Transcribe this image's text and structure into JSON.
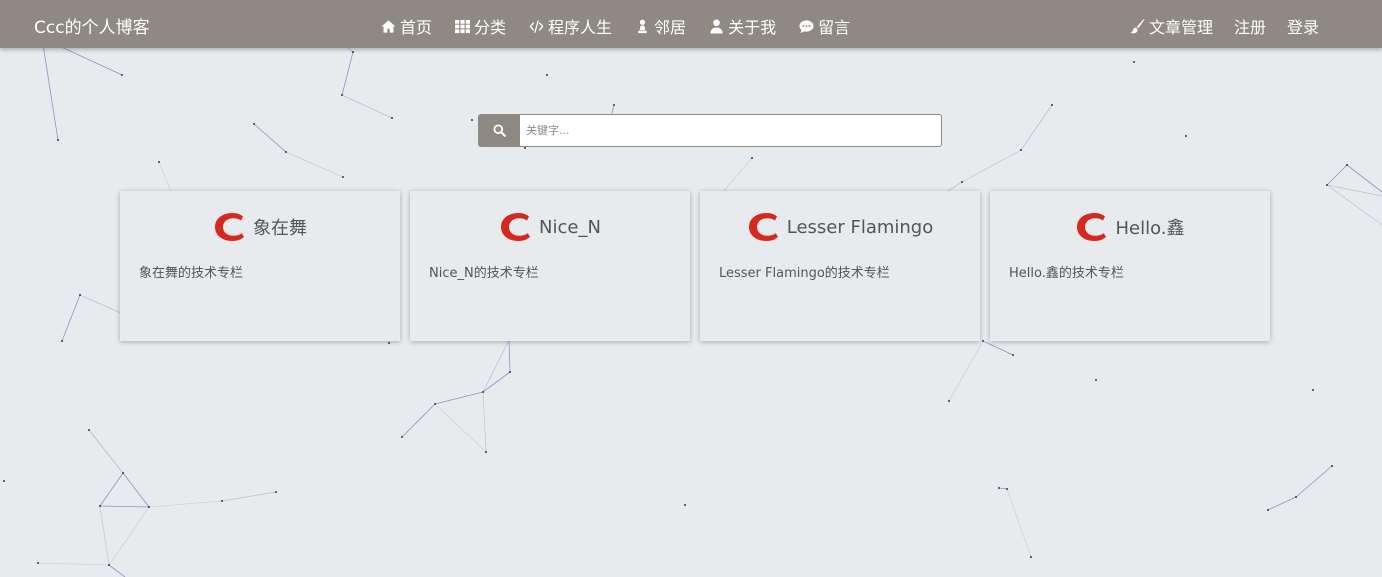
{
  "brand": {
    "title": "Ccc的个人博客"
  },
  "nav": {
    "center": [
      {
        "label": "首页",
        "icon": "home-icon"
      },
      {
        "label": "分类",
        "icon": "grid-icon"
      },
      {
        "label": "程序人生",
        "icon": "code-icon"
      },
      {
        "label": "邻居",
        "icon": "user-badge-icon"
      },
      {
        "label": "关于我",
        "icon": "user-icon"
      },
      {
        "label": "留言",
        "icon": "comment-icon"
      }
    ],
    "right": [
      {
        "label": "文章管理",
        "icon": "brush-icon"
      },
      {
        "label": "注册"
      },
      {
        "label": "登录"
      }
    ]
  },
  "search": {
    "placeholder": "关键字...",
    "value": "",
    "icon": "search-icon"
  },
  "cards": [
    {
      "title": "象在舞",
      "description": "象在舞的技术专栏",
      "logo": "csdn-logo"
    },
    {
      "title": "Nice_N",
      "description": "Nice_N的技术专栏",
      "logo": "csdn-logo"
    },
    {
      "title": "Lesser Flamingo",
      "description": "Lesser Flamingo的技术专栏",
      "logo": "csdn-logo"
    },
    {
      "title": "Hello.鑫",
      "description": "Hello.鑫的技术专栏",
      "logo": "csdn-logo"
    }
  ],
  "colors": {
    "navbar": "#8e8a83",
    "background": "#e8ebee",
    "logo_red": "#d8281e",
    "particle_line": "#7d6fb6"
  }
}
